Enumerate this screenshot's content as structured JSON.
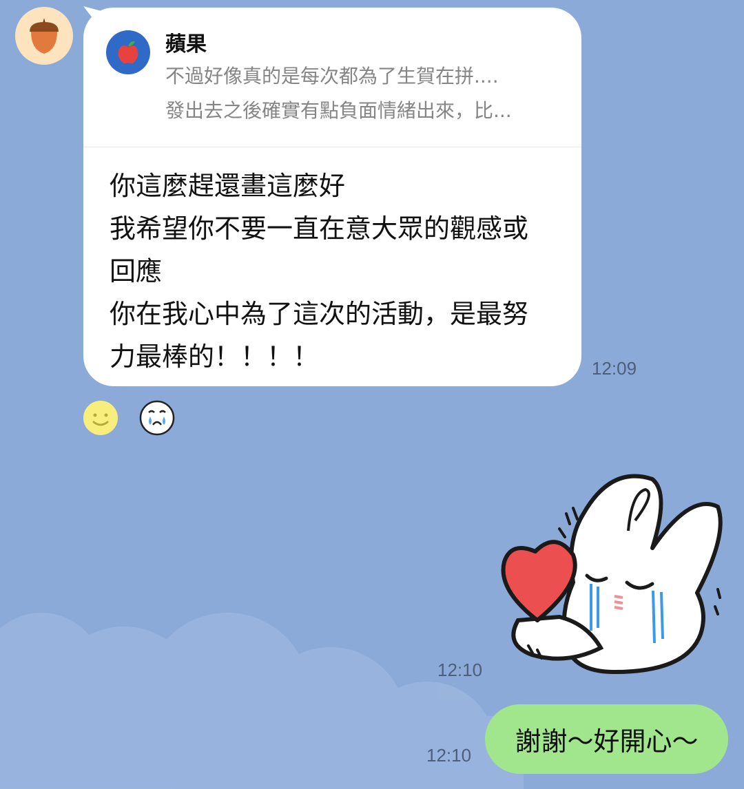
{
  "incoming_message": {
    "reply_to": {
      "sender": "蘋果",
      "preview_line_1": "不過好像真的是每次都為了生賀在拼....",
      "preview_line_2": "發出去之後確實有點負面情緒出來，比..."
    },
    "text_lines": [
      "你這麼趕還畫這麼好",
      "我希望你不要一直在意大眾的觀感或",
      "回應",
      "你在我心中為了這次的活動，是最努",
      "力最棒的！！！！"
    ],
    "time": "12:09",
    "reactions": [
      "smile-emoji",
      "crying-emoji"
    ]
  },
  "sticker_message": {
    "time": "12:10",
    "sticker": "crying-bunny-holding-heart"
  },
  "outgoing_message": {
    "text": "謝謝～好開心～",
    "time": "12:10"
  },
  "colors": {
    "background": "#8caad8",
    "incoming_bubble": "#ffffff",
    "outgoing_bubble": "#a1e58c",
    "heart": "#ec4f4f"
  }
}
